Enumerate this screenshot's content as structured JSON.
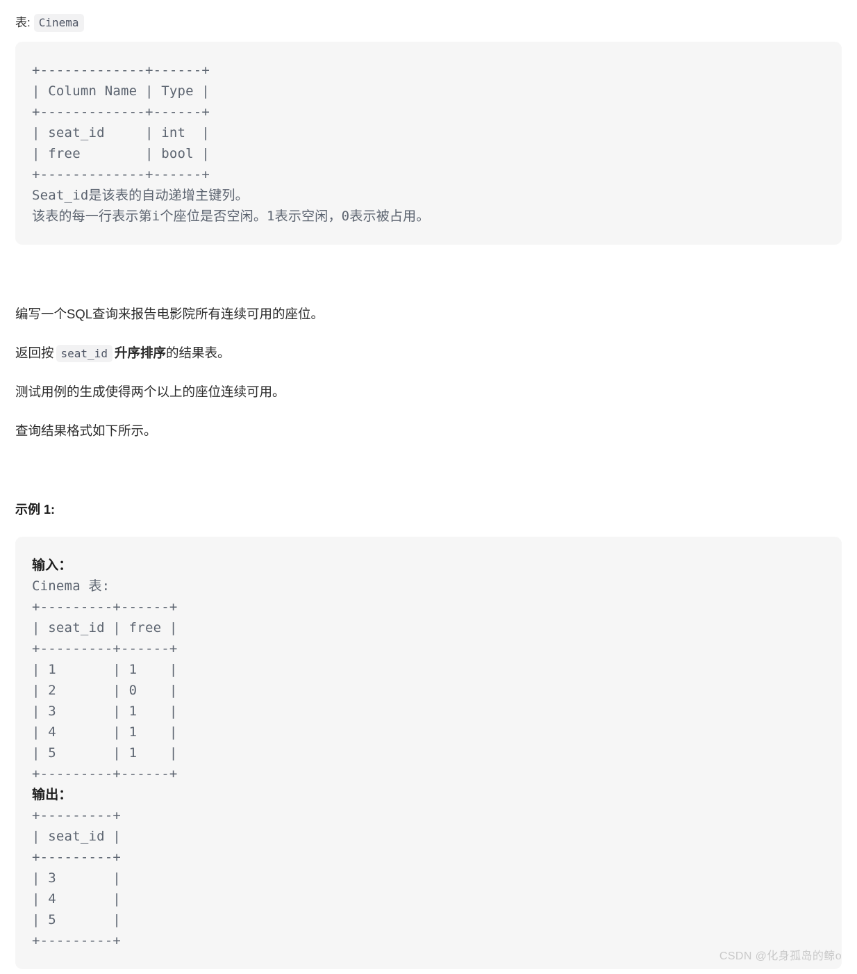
{
  "table_caption": {
    "prefix": "表:",
    "table_name": "Cinema"
  },
  "schema_block": {
    "ascii_table": "+-------------+------+\n| Column Name | Type |\n+-------------+------+\n| seat_id     | int  |\n| free        | bool |\n+-------------+------+",
    "notes": "Seat_id是该表的自动递增主键列。\n该表的每一行表示第i个座位是否空闲。1表示空闲，0表示被占用。"
  },
  "paragraphs": {
    "p1": "编写一个SQL查询来报告电影院所有连续可用的座位。",
    "p2_prefix": "返回按",
    "p2_code": "seat_id",
    "p2_bold": "升序排序",
    "p2_suffix": "的结果表。",
    "p3": "测试用例的生成使得两个以上的座位连续可用。",
    "p4": "查询结果格式如下所示。"
  },
  "example": {
    "heading": "示例 1:",
    "input_label": "输入：",
    "input_table_title": "Cinema 表:",
    "input_ascii": "+---------+------+\n| seat_id | free |\n+---------+------+\n| 1       | 1    |\n| 2       | 0    |\n| 3       | 1    |\n| 4       | 1    |\n| 5       | 1    |\n+---------+------+",
    "output_label": "输出：",
    "output_ascii": "+---------+\n| seat_id |\n+---------+\n| 3       |\n| 4       |\n| 5       |\n+---------+"
  },
  "example_data": {
    "input_columns": [
      "seat_id",
      "free"
    ],
    "input_rows": [
      [
        1,
        1
      ],
      [
        2,
        0
      ],
      [
        3,
        1
      ],
      [
        4,
        1
      ],
      [
        5,
        1
      ]
    ],
    "output_columns": [
      "seat_id"
    ],
    "output_rows": [
      [
        3
      ],
      [
        4
      ],
      [
        5
      ]
    ]
  },
  "schema_data": {
    "columns": [
      "Column Name",
      "Type"
    ],
    "rows": [
      [
        "seat_id",
        "int"
      ],
      [
        "free",
        "bool"
      ]
    ]
  },
  "watermark": "CSDN @化身孤岛的鲸o",
  "colors": {
    "codeblock_background": "#f6f6f6",
    "code_text": "#5c6470",
    "body_text": "#2b2b2b",
    "inline_code_background": "#f2f2f3",
    "watermark": "#c9c9c9"
  }
}
